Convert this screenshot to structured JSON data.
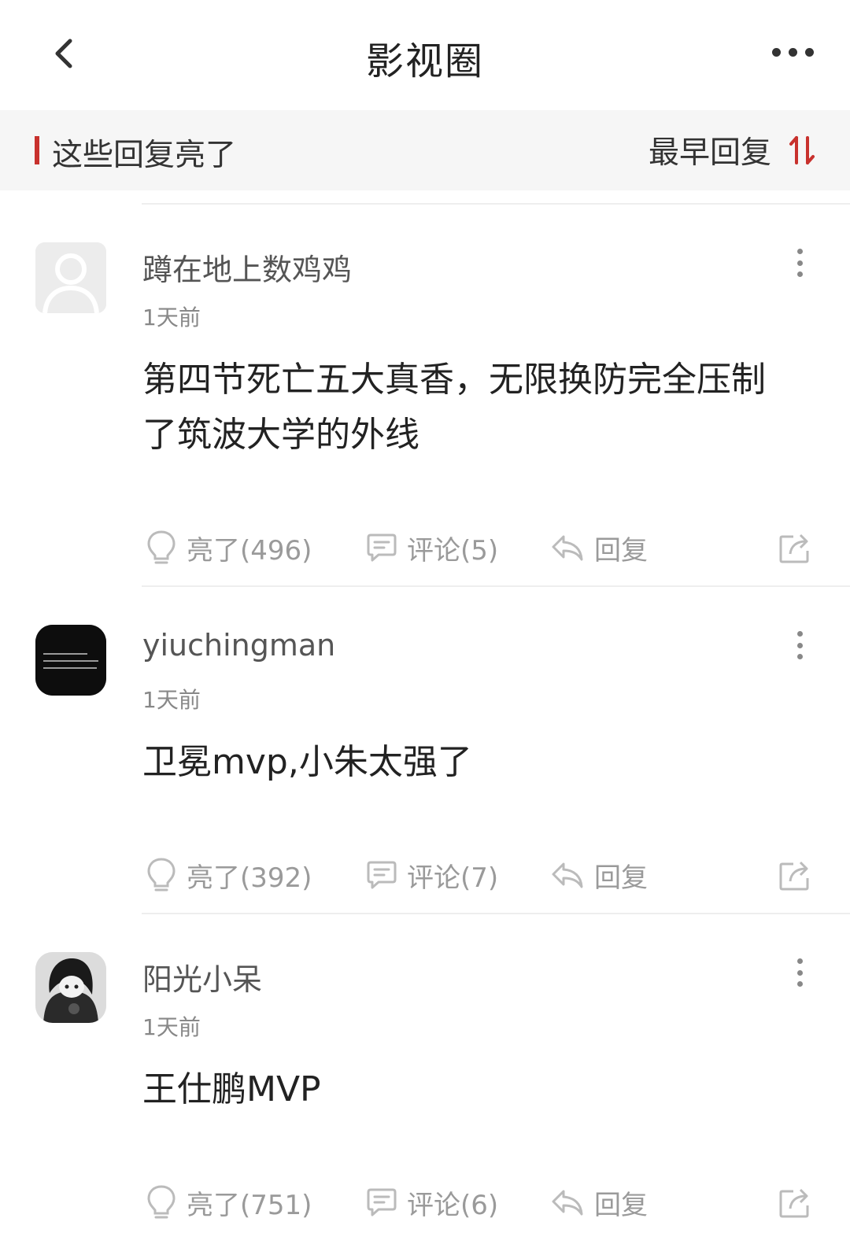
{
  "header": {
    "title": "影视圈",
    "back_icon": "chevron-left-icon",
    "more_icon": "more-horizontal-icon"
  },
  "section": {
    "title": "这些回复亮了",
    "sort_label": "最早回复",
    "sort_icon": "sort-arrows-icon",
    "accent_color": "#c8312d"
  },
  "posts": [
    {
      "username": "蹲在地上数鸡鸡",
      "time": "1天前",
      "content": "第四节死亡五大真香，无限换防完全压制了筑波大学的外线",
      "avatar": "default-avatar",
      "like_label": "亮了(496)",
      "comment_label": "评论(5)",
      "reply_label": "回复"
    },
    {
      "username": "yiuchingman",
      "time": "1天前",
      "content": "卫冕mvp,小朱太强了",
      "avatar": "dark-text-avatar",
      "like_label": "亮了(392)",
      "comment_label": "评论(7)",
      "reply_label": "回复"
    },
    {
      "username": "阳光小呆",
      "time": "1天前",
      "content": "王仕鹏MVP",
      "avatar": "anime-avatar",
      "like_label": "亮了(751)",
      "comment_label": "评论(6)",
      "reply_label": "回复"
    }
  ]
}
